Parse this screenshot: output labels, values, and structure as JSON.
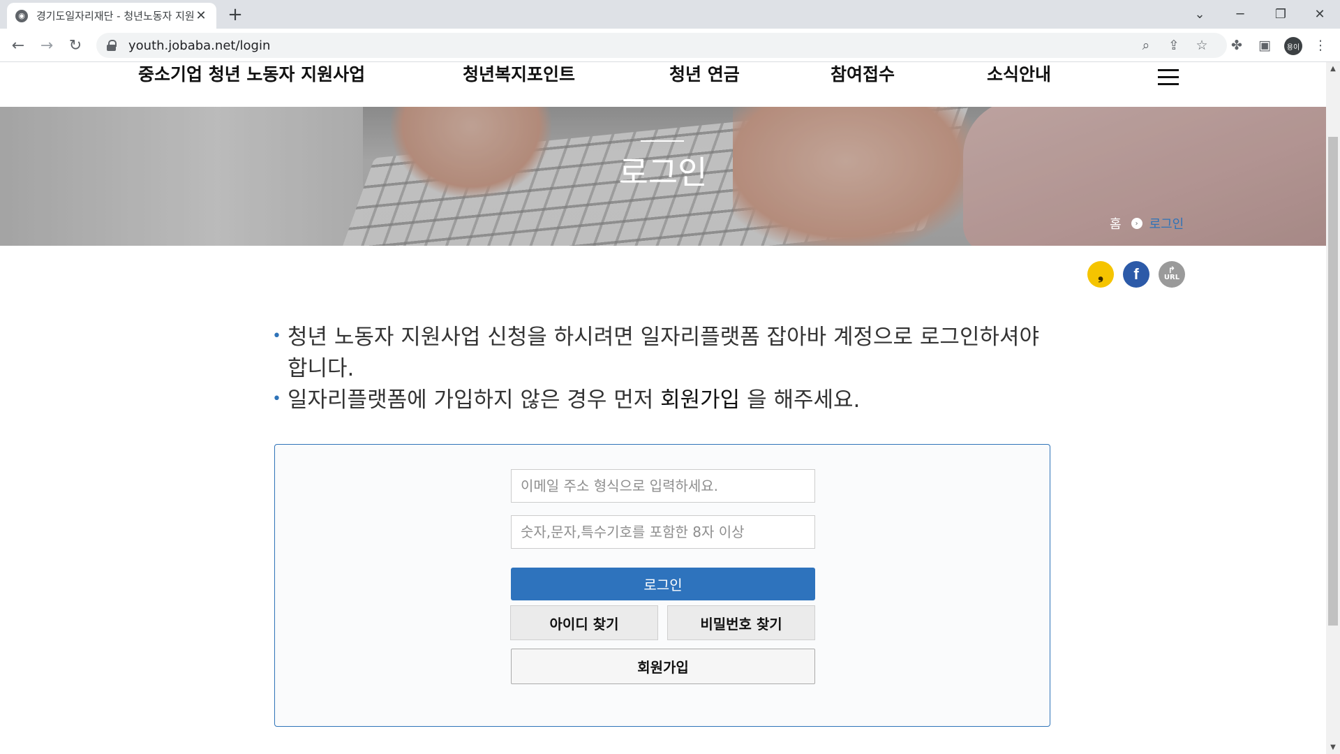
{
  "browser": {
    "tab_title": "경기도일자리재단 - 청년노동자 지원사업",
    "favicon": "globe-icon",
    "url": "youth.jobaba.net/login",
    "profile_label": "용이"
  },
  "gnb": {
    "items": [
      {
        "label": "중소기업 청년 노동자 지원사업"
      },
      {
        "label": "청년복지포인트"
      },
      {
        "label": "청년 연금"
      },
      {
        "label": "참여접수"
      },
      {
        "label": "소식안내"
      }
    ]
  },
  "hero": {
    "title": "로그인",
    "breadcrumb": {
      "home": "홈",
      "current": "로그인"
    }
  },
  "share": {
    "url_label": "URL"
  },
  "notice": {
    "line1": "청년 노동자 지원사업 신청을 하시려면 일자리플랫폼 잡아바 계정으로 로그인하셔야 합니다.",
    "line2_prefix": "일자리플랫폼에 가입하지 않은 경우 먼저",
    "line2_link": "회원가입",
    "line2_suffix": "을 해주세요."
  },
  "login": {
    "email_placeholder": "이메일 주소 형식으로 입력하세요.",
    "password_placeholder": "숫자,문자,특수기호를 포함한 8자 이상",
    "login_label": "로그인",
    "find_id_label": "아이디 찾기",
    "find_password_label": "비밀번호 찾기",
    "join_label": "회원가입"
  },
  "colors": {
    "accent": "#2e73bd",
    "kakao": "#f5c400",
    "facebook": "#2c5aa8"
  }
}
